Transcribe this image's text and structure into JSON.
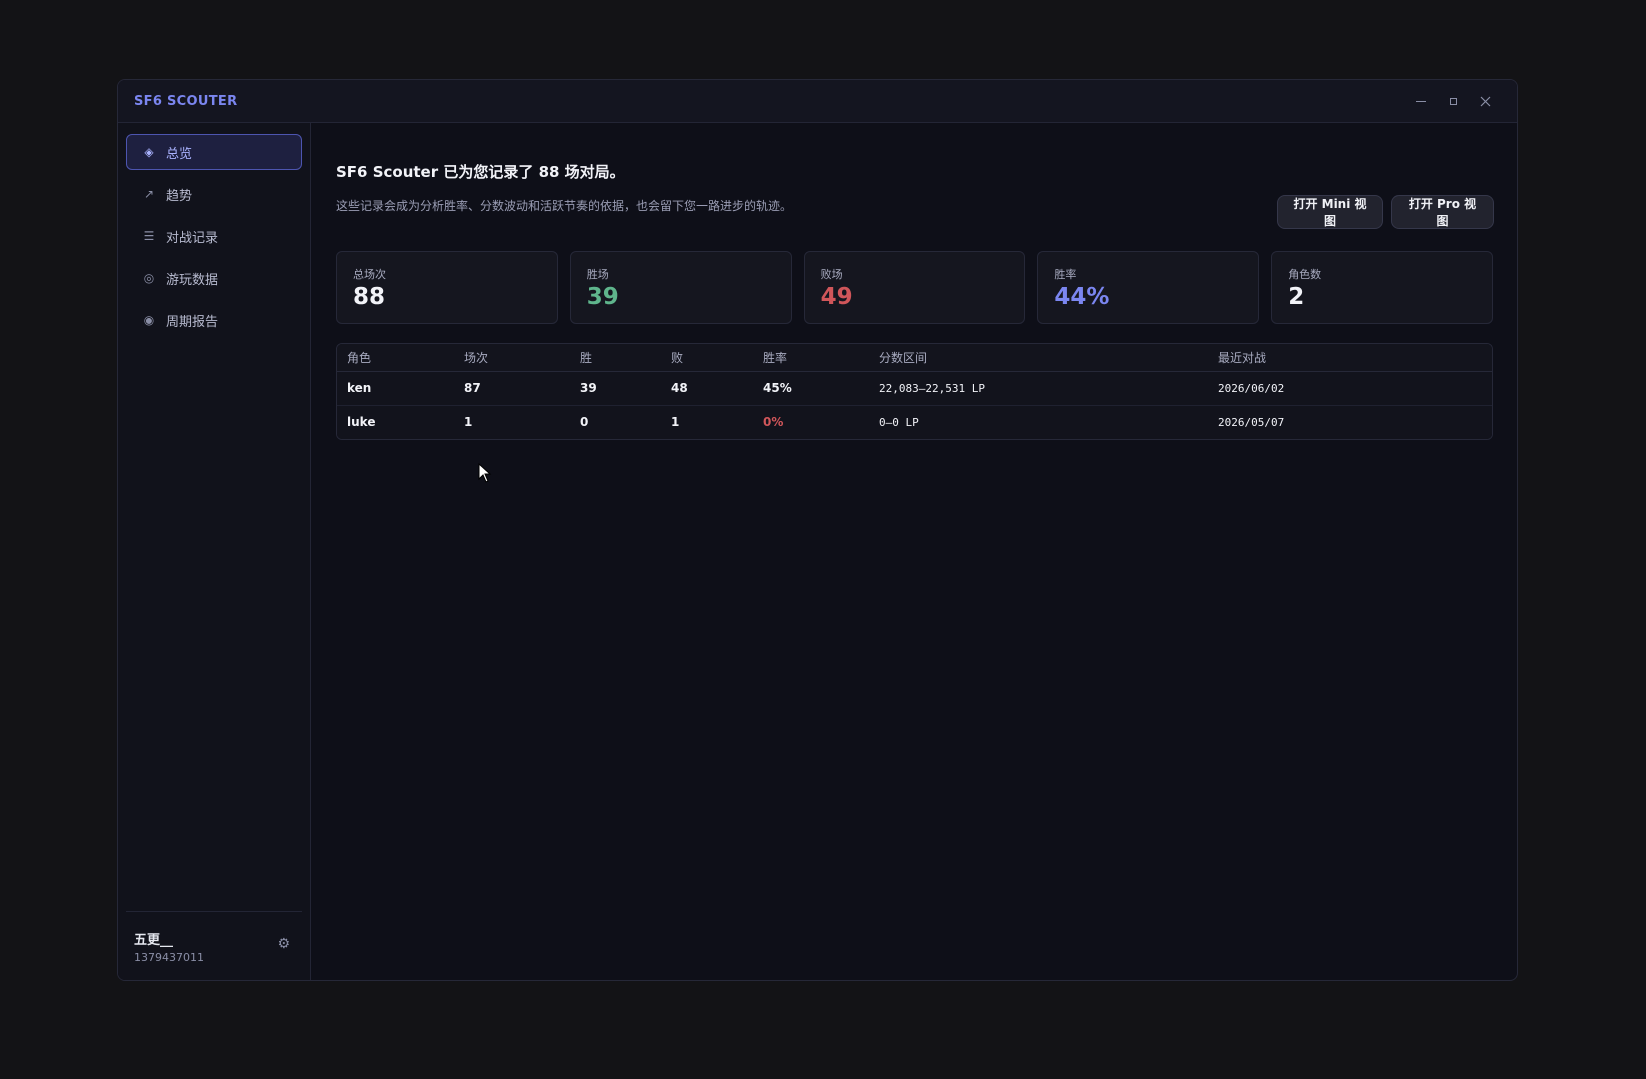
{
  "window": {
    "title": "SF6 SCOUTER"
  },
  "sidebar": {
    "items": [
      {
        "label": "总览",
        "icon": "◈",
        "icon_name": "diamond-icon",
        "active": true
      },
      {
        "label": "趋势",
        "icon": "↗",
        "icon_name": "trend-arrow-icon",
        "active": false
      },
      {
        "label": "对战记录",
        "icon": "☰",
        "icon_name": "list-icon",
        "active": false
      },
      {
        "label": "游玩数据",
        "icon": "◎",
        "icon_name": "target-icon",
        "active": false
      },
      {
        "label": "周期报告",
        "icon": "◉",
        "icon_name": "report-circle-icon",
        "active": false
      }
    ],
    "user": {
      "name": "五更__",
      "id": "1379437011",
      "settings_icon": "⚙"
    }
  },
  "main": {
    "headline": "SF6 Scouter 已为您记录了 88 场对局。",
    "subline": "这些记录会成为分析胜率、分数波动和活跃节奏的依据，也会留下您一路进步的轨迹。",
    "buttons": {
      "mini": "打开 Mini 视图",
      "pro": "打开 Pro 视图"
    },
    "stats": [
      {
        "label": "总场次",
        "value": "88",
        "color": "#f2f3f8"
      },
      {
        "label": "胜场",
        "value": "39",
        "color": "#5fb58c"
      },
      {
        "label": "败场",
        "value": "49",
        "color": "#d0565a"
      },
      {
        "label": "胜率",
        "value": "44%",
        "color": "#7b86f0"
      },
      {
        "label": "角色数",
        "value": "2",
        "color": "#f2f3f8"
      }
    ],
    "table": {
      "headers": [
        "角色",
        "场次",
        "胜",
        "败",
        "胜率",
        "分数区间",
        "最近对战"
      ],
      "rows": [
        {
          "character": "ken",
          "matches": "87",
          "wins": "39",
          "losses": "48",
          "winrate": "45%",
          "winrate_color": "#f2f3f8",
          "lp_range": "22,083–22,531 LP",
          "last": "2026/06/02"
        },
        {
          "character": "luke",
          "matches": "1",
          "wins": "0",
          "losses": "1",
          "winrate": "0%",
          "winrate_color": "#d0565a",
          "lp_range": "0–0 LP",
          "last": "2026/05/07"
        }
      ]
    }
  },
  "colors": {
    "accent": "#7b86f0",
    "win": "#5fb58c",
    "loss": "#d0565a"
  }
}
